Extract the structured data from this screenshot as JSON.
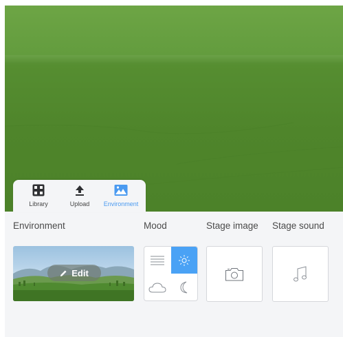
{
  "tabs": [
    {
      "label": "Library",
      "icon": "library-icon"
    },
    {
      "label": "Upload",
      "icon": "upload-icon"
    },
    {
      "label": "Environment",
      "icon": "environment-icon",
      "active": true
    }
  ],
  "sections": {
    "environment": "Environment",
    "mood": "Mood",
    "stage_image": "Stage image",
    "stage_sound": "Stage sound"
  },
  "environment_card": {
    "edit_label": "Edit"
  },
  "mood_options": [
    {
      "icon": "fog-icon",
      "selected": false
    },
    {
      "icon": "sun-icon",
      "selected": true
    },
    {
      "icon": "cloud-icon",
      "selected": false
    },
    {
      "icon": "moon-icon",
      "selected": false
    }
  ],
  "stage_image_card": {
    "icon": "camera-icon"
  },
  "stage_sound_card": {
    "icon": "music-note-icon"
  },
  "colors": {
    "accent": "#4a9af0",
    "stage_green": "#4f852b",
    "panel_bg": "#f4f5f7"
  }
}
